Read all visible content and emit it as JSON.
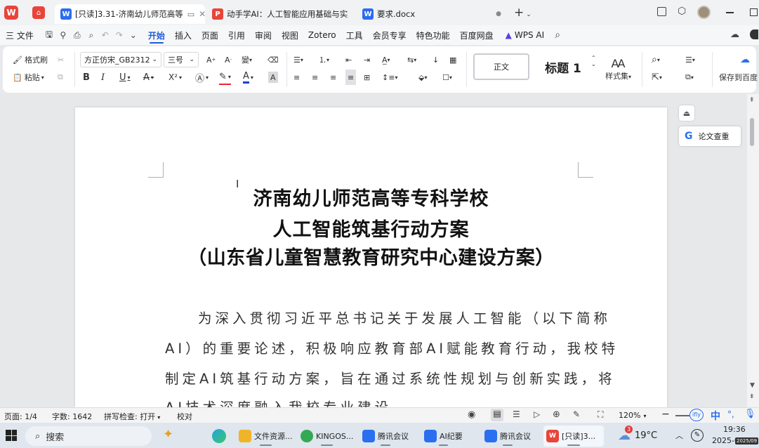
{
  "window": {
    "tabs": [
      {
        "label": "[只读]3.31-济南幼儿师范高等",
        "icon": "W",
        "color": "#2b6cf0",
        "active": true
      },
      {
        "label": "动手学AI：人工智能应用基础与实践",
        "icon": "P",
        "color": "#e8443a",
        "active": false
      },
      {
        "label": "要求.docx",
        "icon": "W",
        "color": "#2b6cf0",
        "active": false
      }
    ],
    "new_tab": "+"
  },
  "menu": {
    "file": "三 文件",
    "items": [
      "开始",
      "插入",
      "页面",
      "引用",
      "审阅",
      "视图",
      "Zotero",
      "工具",
      "会员专享",
      "特色功能",
      "百度网盘"
    ],
    "active": "开始",
    "wps_ai": "WPS AI"
  },
  "ribbon": {
    "format_painter": "格式刷",
    "paste": "粘贴",
    "font_name": "方正仿宋_GB2312",
    "font_size": "三号",
    "style_normal": "正文",
    "style_heading": "标题 1",
    "style_set": "样式集",
    "save_to_baidu": "保存到百度",
    "bold": "B",
    "italic": "I",
    "underline": "U",
    "strike": "A",
    "superscript": "X²",
    "font_color": "A",
    "char_shade": "A"
  },
  "side_panel": {
    "paper_check": "论文查重"
  },
  "document": {
    "title_lines": [
      "济南幼儿师范高等专科学校",
      "人工智能筑基行动方案",
      "（山东省儿童智慧教育研究中心建设方案）"
    ],
    "body_lines": [
      "为深入贯彻习近平总书记关于发展人工智能（以下简称",
      "AI）的重要论述，积极响应教育部AI赋能教育行动，我校特",
      "制定AI筑基行动方案，旨在通过系统性规划与创新实践，将",
      "AI技术深度融入我校专业建设"
    ]
  },
  "status": {
    "page": "页面: 1/4",
    "words": "字数: 1642",
    "spell": "拼写检查: 打开",
    "proof": "校对",
    "zoom": "120%",
    "ime": "中"
  },
  "taskbar": {
    "search": "搜索",
    "apps": [
      {
        "label": "文件资源...",
        "color": "#f0b429",
        "icon": ""
      },
      {
        "label": "KINGOS...",
        "color": "#34a853",
        "icon": ""
      },
      {
        "label": "腾讯会议",
        "color": "#2a6ff0",
        "icon": ""
      },
      {
        "label": "AI纪要",
        "color": "#2a6ff0",
        "icon": ""
      },
      {
        "label": "腾讯会议",
        "color": "#2a6ff0",
        "icon": ""
      },
      {
        "label": "[只读]3...",
        "color": "#e8443a",
        "icon": "W"
      }
    ],
    "weather": "19°C",
    "weather_badge": "3",
    "time": "19:36",
    "date": "2025-0",
    "date_badge": "2025/09"
  }
}
